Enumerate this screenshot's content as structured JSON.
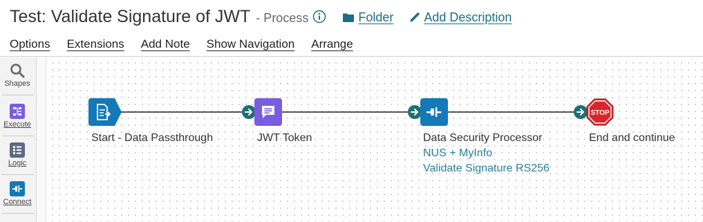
{
  "header": {
    "title": "Test: Validate Signature of JWT",
    "subtitle": "- Process",
    "folder_label": "Folder",
    "add_description_label": "Add Description"
  },
  "menu": {
    "items": [
      "Options",
      "Extensions",
      "Add Note",
      "Show Navigation",
      "Arrange"
    ]
  },
  "palette": {
    "shapes_label": "Shapes",
    "execute_label": "Execute",
    "logic_label": "Logic",
    "connect_label": "Connect"
  },
  "process": {
    "nodes": [
      {
        "label": "Start - Data Passthrough",
        "icon": "start-doc-icon"
      },
      {
        "label": "JWT Token",
        "icon": "message-icon"
      },
      {
        "label": "Data Security Processor",
        "icon": "connector-plug-icon",
        "sub": [
          "NUS + MyInfo",
          "Validate Signature RS256"
        ]
      },
      {
        "label": "End and continue",
        "icon": "stop-icon",
        "stop_text": "STOP"
      }
    ]
  },
  "colors": {
    "link": "#1a6f86",
    "start_node": "#1479b8",
    "message_node": "#7a5ce0",
    "connector_node": "#1479b8",
    "stop_node": "#d9262c",
    "arrow": "#1d6f74"
  }
}
